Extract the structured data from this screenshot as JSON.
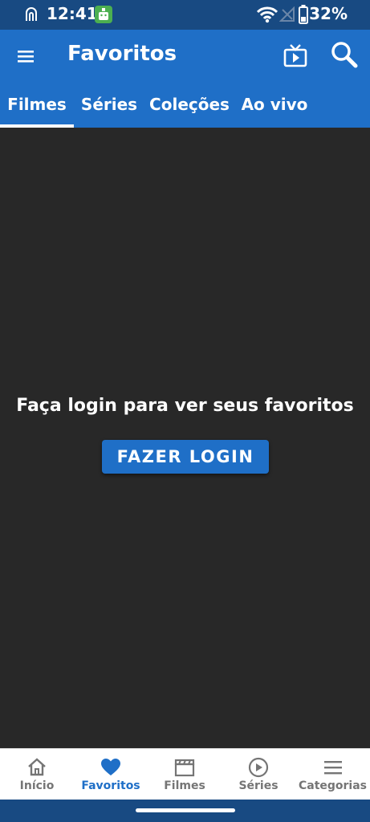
{
  "status_bar": {
    "time": "12:41",
    "battery": "32%",
    "icons": [
      "nfc-icon",
      "android-debug-icon",
      "wifi-icon",
      "signal-icon",
      "battery-icon"
    ]
  },
  "app_bar": {
    "title": "Favoritos",
    "icons": [
      "menu-icon",
      "cast-tv-icon",
      "search-icon"
    ]
  },
  "tabs": [
    {
      "label": "Filmes",
      "active": true
    },
    {
      "label": "Séries",
      "active": false
    },
    {
      "label": "Coleções",
      "active": false
    },
    {
      "label": "Ao vivo",
      "active": false
    }
  ],
  "main": {
    "message": "Faça login para ver seus favoritos",
    "login_button": "FAZER LOGIN"
  },
  "bottom_nav": [
    {
      "label": "Início",
      "icon": "home-icon",
      "active": false
    },
    {
      "label": "Favoritos",
      "icon": "heart-icon",
      "active": true
    },
    {
      "label": "Filmes",
      "icon": "clapperboard-icon",
      "active": false
    },
    {
      "label": "Séries",
      "icon": "play-circle-icon",
      "active": false
    },
    {
      "label": "Categorias",
      "icon": "list-icon",
      "active": false
    }
  ],
  "colors": {
    "primary": "#1f6fc7",
    "status_bar": "#184a82",
    "background": "#282828",
    "nav_active": "#1f6fc7",
    "nav_inactive": "#757575"
  }
}
